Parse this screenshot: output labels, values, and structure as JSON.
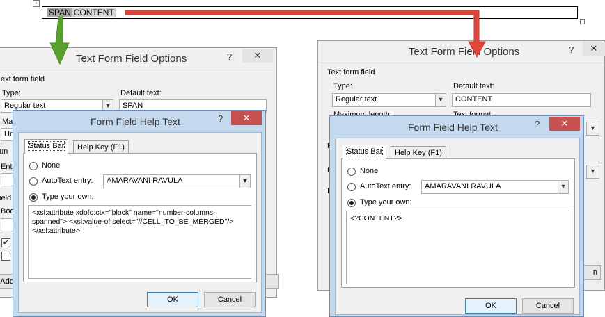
{
  "document": {
    "selected_text_1": "SPAN",
    "selected_text_2": "CONTENT"
  },
  "left_options": {
    "title": "Text Form Field Options",
    "help_button": "?",
    "close_button": "✕",
    "group_label": "ext form field",
    "type_label": "Type:",
    "type_value": "Regular text",
    "default_text_label": "Default text:",
    "default_text_value": "SPAN",
    "max_length_label": "Ma",
    "max_value": "Ur",
    "frag_un": "un",
    "frag_ent": "Ent",
    "frag_field": "ield",
    "frag_boo": "Boo",
    "add_button": "Add"
  },
  "left_help": {
    "title": "Form Field Help Text",
    "help_button": "?",
    "close_button": "✕",
    "tab_status": "Status Bar",
    "tab_help": "Help Key (F1)",
    "radio_none": "None",
    "radio_autotext": "AutoText entry:",
    "autotext_value": "AMARAVANI RAVULA",
    "radio_own": "Type your own:",
    "own_text": "<xsl:attribute xdofo:ctx=\"block\" name=\"number-columns-spanned\"> <xsl:value-of select=\"//CELL_TO_BE_MERGED\"/> </xsl:attribute>",
    "ok": "OK",
    "cancel": "Cancel"
  },
  "right_options": {
    "title": "Text Form Field Options",
    "help_button": "?",
    "close_button": "✕",
    "group_label": "Text form field",
    "type_label": "Type:",
    "type_value": "Regular text",
    "default_text_label": "Default text:",
    "default_text_value": "CONTENT",
    "max_length_label": "Maximum length:",
    "text_format_label": "Text format:",
    "frag_f": "F",
    "frag_r": "R",
    "frag_i": "I",
    "frag_n": "n"
  },
  "right_help": {
    "title": "Form Field Help Text",
    "help_button": "?",
    "close_button": "✕",
    "tab_status": "Status Bar",
    "tab_help": "Help Key (F1)",
    "radio_none": "None",
    "radio_autotext": "AutoText entry:",
    "autotext_value": "AMARAVANI RAVULA",
    "radio_own": "Type your own:",
    "own_text": "<?CONTENT?>",
    "ok": "OK",
    "cancel": "Cancel"
  },
  "colors": {
    "green_arrow": "#5aa02c",
    "red_arrow": "#e0473c",
    "close_red": "#c75050"
  }
}
